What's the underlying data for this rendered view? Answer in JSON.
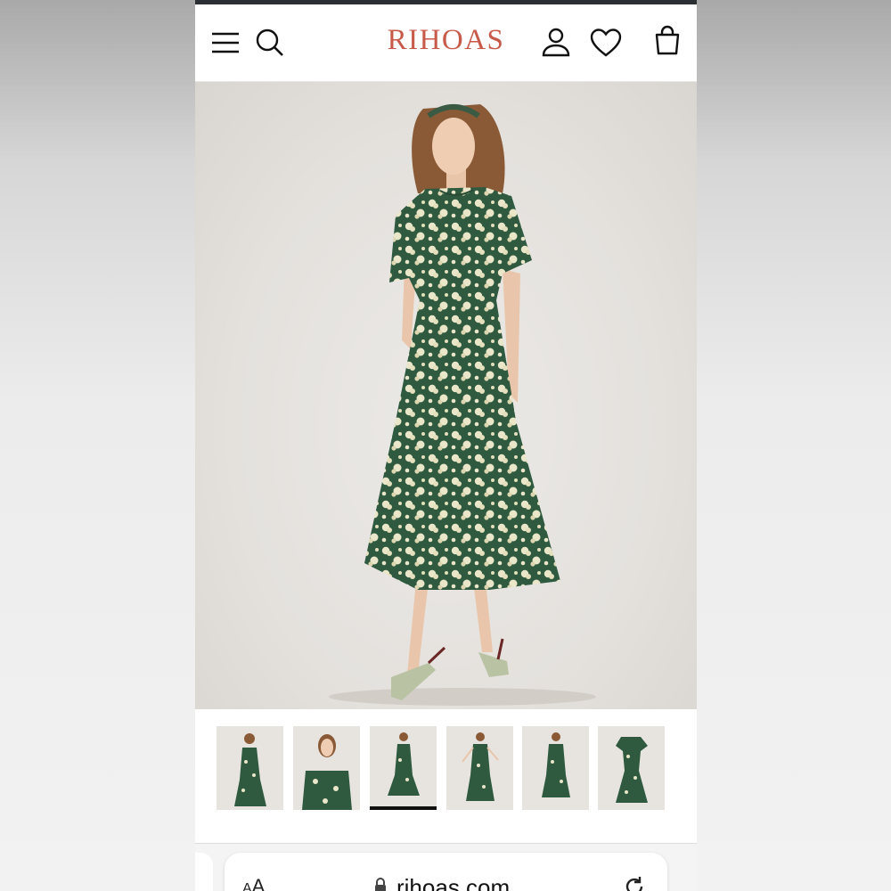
{
  "header": {
    "brand": "RIHOAS",
    "brand_color": "#c85a4a",
    "icons": [
      "menu-icon",
      "search-icon",
      "account-icon",
      "wishlist-heart-icon",
      "shopping-bag-icon"
    ]
  },
  "product": {
    "dress_color": "#2f5a3f",
    "print_color": "#eae6c9",
    "shoe_color": "#b9c3a4",
    "thumbnails_count": 6,
    "selected_thumbnail": 3
  },
  "browser": {
    "text_size_label_small": "A",
    "text_size_label_large": "A",
    "url": "rihoas.com"
  }
}
